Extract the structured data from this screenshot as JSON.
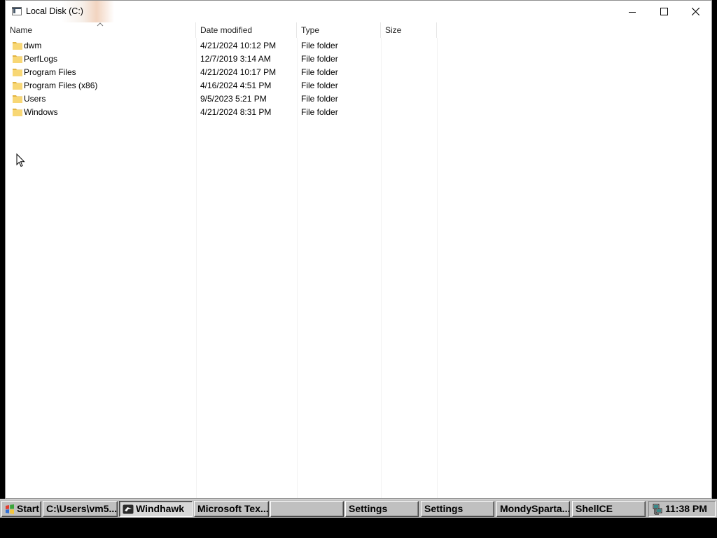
{
  "window": {
    "title": "Local Disk (C:)"
  },
  "columns": {
    "name": "Name",
    "date": "Date modified",
    "type": "Type",
    "size": "Size"
  },
  "files": [
    {
      "name": "dwm",
      "date": "4/21/2024 10:12 PM",
      "type": "File folder"
    },
    {
      "name": "PerfLogs",
      "date": "12/7/2019 3:14 AM",
      "type": "File folder"
    },
    {
      "name": "Program Files",
      "date": "4/21/2024 10:17 PM",
      "type": "File folder"
    },
    {
      "name": "Program Files (x86)",
      "date": "4/16/2024 4:51 PM",
      "type": "File folder"
    },
    {
      "name": "Users",
      "date": "9/5/2023 5:21 PM",
      "type": "File folder"
    },
    {
      "name": "Windows",
      "date": "4/21/2024 8:31 PM",
      "type": "File folder"
    }
  ],
  "taskbar": {
    "start": "Start",
    "items": [
      {
        "label": "C:\\Users\\vm5..."
      },
      {
        "label": "Windhawk"
      },
      {
        "label": "Microsoft Tex..."
      },
      {
        "label": ""
      },
      {
        "label": "Settings"
      },
      {
        "label": "Settings"
      },
      {
        "label": "MondySparta..."
      },
      {
        "label": "ShellCE"
      }
    ],
    "clock": "11:38 PM"
  },
  "colors": {
    "folder": "#f8d775",
    "folder_dark": "#e2b443",
    "taskbar": "#c0c0c0"
  }
}
